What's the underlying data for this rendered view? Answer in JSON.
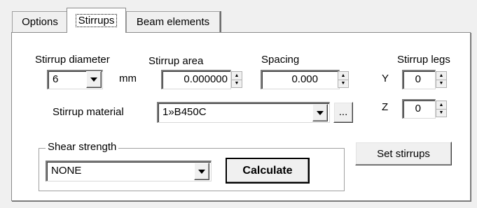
{
  "tabs": [
    {
      "label": "Options"
    },
    {
      "label": "Stirrups"
    },
    {
      "label": "Beam elements"
    }
  ],
  "diameter": {
    "label": "Stirrup diameter",
    "value": "6",
    "unit": "mm"
  },
  "area": {
    "label": "Stirrup area",
    "value": "0.000000"
  },
  "spacing": {
    "label": "Spacing",
    "value": "0.000"
  },
  "legs": {
    "label": "Stirrup legs",
    "y_label": "Y",
    "y_value": "0",
    "z_label": "Z",
    "z_value": "0"
  },
  "material": {
    "label": "Stirrup material",
    "value": "1»B450C",
    "browse_label": "..."
  },
  "shear": {
    "legend": "Shear strength",
    "value": "NONE",
    "calculate_label": "Calculate"
  },
  "set_stirrups_label": "Set stirrups"
}
